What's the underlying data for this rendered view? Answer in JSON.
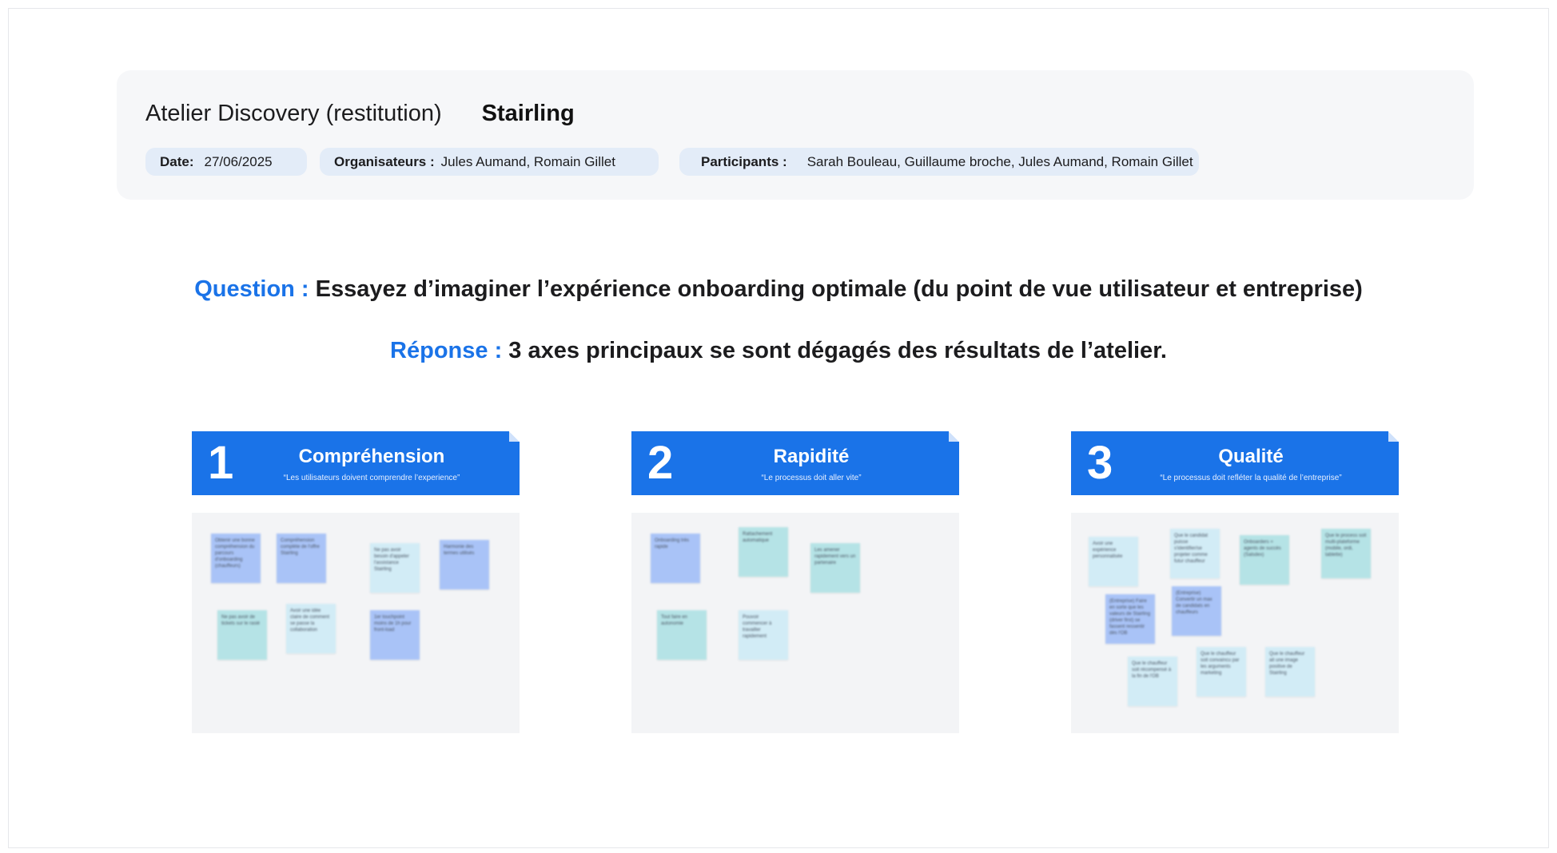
{
  "header": {
    "title": "Atelier Discovery (restitution)",
    "brand": "Stairling",
    "date_label": "Date:",
    "date_value": "27/06/2025",
    "organizers_label": "Organisateurs :",
    "organizers_value": "Jules Aumand, Romain Gillet",
    "participants_label": "Participants :",
    "participants_value": "Sarah Bouleau, Guillaume broche, Jules Aumand, Romain Gillet"
  },
  "question": {
    "label": "Question :",
    "text": " Essayez d’imaginer l’expérience onboarding optimale (du point de vue utilisateur et entreprise)"
  },
  "response": {
    "label": "Réponse :",
    "text": " 3 axes principaux se sont dégagés des résultats de l’atelier."
  },
  "colors": {
    "accent": "#1a73e8",
    "header_bg": "#f6f7f9",
    "chip_bg": "#e3ecf8",
    "sticky_blue": "#a9c3f7",
    "sticky_teal": "#b5e3e6",
    "sticky_light": "#d2ecf6"
  },
  "axes": [
    {
      "number": "1",
      "title": "Compréhension",
      "subtitle": "“Les utilisateurs doivent comprendre l’experience”",
      "stickies": [
        {
          "text": "Obtenir une bonne compréhension du parcours d'onboarding (chauffeurs)",
          "color": "blue"
        },
        {
          "text": "Compréhension complète de l'offre Stairling",
          "color": "blue"
        },
        {
          "text": "Ne pas avoir besoin d'appeler l'assistance Stairling",
          "color": "light"
        },
        {
          "text": "Harmonie des termes utilisés",
          "color": "blue"
        },
        {
          "text": "Ne pas avoir de tickets sur le rasié",
          "color": "teal"
        },
        {
          "text": "Avoir une idée claire de comment se passe la collaboration",
          "color": "light"
        },
        {
          "text": "1er touchpoint moins de 1h pour front-load",
          "color": "blue"
        }
      ]
    },
    {
      "number": "2",
      "title": "Rapidité",
      "subtitle": "“Le processus doit aller vite”",
      "stickies": [
        {
          "text": "Onboarding très rapide",
          "color": "blue"
        },
        {
          "text": "Rattachement automatique",
          "color": "teal"
        },
        {
          "text": "Les amener rapidement vers un partenaire",
          "color": "teal"
        },
        {
          "text": "Tout faire en autonomie",
          "color": "teal"
        },
        {
          "text": "Pouvoir commencer à travailler rapidement",
          "color": "light"
        }
      ]
    },
    {
      "number": "3",
      "title": "Qualité",
      "subtitle": "“Le processus doit refléter la qualité de l’entreprise”",
      "stickies": [
        {
          "text": "Avoir une expérience personnalisée",
          "color": "light"
        },
        {
          "text": "Que le candidat puisse s'identifier/se projeter comme futur chauffeur",
          "color": "light"
        },
        {
          "text": "Onboarders = agents de succès (Salsdex)",
          "color": "teal"
        },
        {
          "text": "Que le process soit multi-plateforme (mobile, ordi, tablette)",
          "color": "teal"
        },
        {
          "text": "(Entreprise) Faire en sorte que les valeurs de Stairling (driver first) se fassent ressentir dès l'OB",
          "color": "blue"
        },
        {
          "text": "(Entreprise) Convertir un max de candidats en chauffeurs",
          "color": "blue"
        },
        {
          "text": "Que le chauffeur soit récompensé à la fin de l'OB",
          "color": "light"
        },
        {
          "text": "Que le chauffeur soit convaincu par les arguments marketing",
          "color": "light"
        },
        {
          "text": "Que le chauffeur ait une image positive de Stairling",
          "color": "light"
        }
      ]
    }
  ]
}
